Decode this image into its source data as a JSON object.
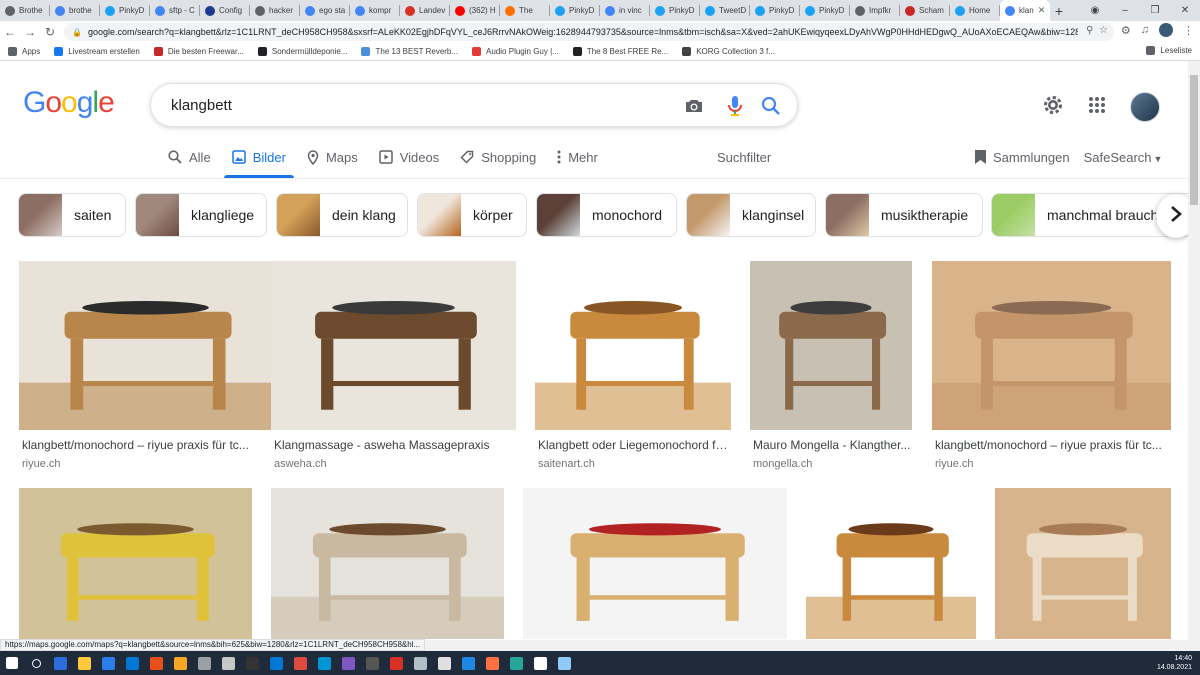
{
  "browser": {
    "tabs": [
      {
        "label": "Brothe",
        "color": "#5f6368",
        "icon": "globe-icon"
      },
      {
        "label": "brothe",
        "color": "#4285f4",
        "icon": "google-icon"
      },
      {
        "label": "PinkyD",
        "color": "#1da1f2",
        "icon": "twitter-icon"
      },
      {
        "label": "sftp - C",
        "color": "#4285f4",
        "icon": "google-icon"
      },
      {
        "label": "Config",
        "color": "#1a3a8f",
        "icon": "config-icon"
      },
      {
        "label": "hacker",
        "color": "#5f6368",
        "icon": "globe-icon"
      },
      {
        "label": "ego sta",
        "color": "#4285f4",
        "icon": "google-icon"
      },
      {
        "label": "kompr",
        "color": "#4285f4",
        "icon": "google-icon"
      },
      {
        "label": "Landev",
        "color": "#d93025",
        "icon": "bookmark-icon"
      },
      {
        "label": "(362) H",
        "color": "#ff0000",
        "icon": "youtube-icon"
      },
      {
        "label": "The",
        "color": "#ff6f00",
        "icon": "audio-icon"
      },
      {
        "label": "PinkyD",
        "color": "#1da1f2",
        "icon": "twitter-icon"
      },
      {
        "label": "in vinc",
        "color": "#4285f4",
        "icon": "google-icon"
      },
      {
        "label": "PinkyD",
        "color": "#1da1f2",
        "icon": "twitter-icon"
      },
      {
        "label": "TweetD",
        "color": "#1da1f2",
        "icon": "tweetdeck-icon"
      },
      {
        "label": "PinkyD",
        "color": "#1da1f2",
        "icon": "twitter-icon"
      },
      {
        "label": "PinkyD",
        "color": "#1da1f2",
        "icon": "twitter-icon"
      },
      {
        "label": "Impfkr",
        "color": "#5f6368",
        "icon": "wikipedia-icon"
      },
      {
        "label": "Scham",
        "color": "#c62828",
        "icon": "bookmark-icon"
      },
      {
        "label": "Home",
        "color": "#1da1f2",
        "icon": "twitter-icon"
      }
    ],
    "active_tab": {
      "label": "klan",
      "color": "#4285f4"
    },
    "url": "google.com/search?q=klangbett&rlz=1C1LRNT_deCH958CH958&sxsrf=ALeKK02EgjhDFqVYL_ceJ6RrrvNAkOWeig:1628944793735&source=lnms&tbm=isch&sa=X&ved=2ahUKEwiqyqeexLDyAhVWgP0HHdHEDgwQ_AUoAXoECAEQAw&biw=1280&bih=...",
    "bookmarks": [
      {
        "label": "Apps",
        "color": "#5f6368"
      },
      {
        "label": "Livestream erstellen",
        "color": "#1877f2"
      },
      {
        "label": "Die besten Freewar...",
        "color": "#c62828"
      },
      {
        "label": "Sondermülldeponie...",
        "color": "#202124"
      },
      {
        "label": "The 13 BEST Reverb...",
        "color": "#4a90d9"
      },
      {
        "label": "Audio Plugin Guy |...",
        "color": "#e53935"
      },
      {
        "label": "The 8 Best FREE Re...",
        "color": "#202124"
      },
      {
        "label": "KORG Collection 3 f...",
        "color": "#424242"
      }
    ],
    "reading_list": "Leseliste"
  },
  "search": {
    "query": "klangbett"
  },
  "nav": {
    "tabs": [
      {
        "label": "Alle",
        "icon": "search-icon"
      },
      {
        "label": "Bilder",
        "icon": "image-icon",
        "active": true
      },
      {
        "label": "Maps",
        "icon": "map-pin-icon"
      },
      {
        "label": "Videos",
        "icon": "video-icon"
      },
      {
        "label": "Shopping",
        "icon": "tag-icon"
      },
      {
        "label": "Mehr",
        "icon": "more-vert-icon"
      }
    ],
    "suchfilter": "Suchfilter",
    "sammlungen": "Sammlungen",
    "safesearch": "SafeSearch"
  },
  "chips": [
    {
      "label": "saiten",
      "c1": "#8d6e63",
      "c2": "#d7ccc8"
    },
    {
      "label": "klangliege",
      "c1": "#a1887f",
      "c2": "#6d4c41"
    },
    {
      "label": "dein klang",
      "c1": "#d4a15a",
      "c2": "#8a5a2b"
    },
    {
      "label": "körper",
      "c1": "#efe6dc",
      "c2": "#b5651d"
    },
    {
      "label": "monochord",
      "c1": "#5d4037",
      "c2": "#cfd8dc"
    },
    {
      "label": "klanginsel",
      "c1": "#c49a6c",
      "c2": "#f5f5f5"
    },
    {
      "label": "musiktherapie",
      "c1": "#8d6e63",
      "c2": "#e0c9a6"
    },
    {
      "label": "manchmal braucht",
      "c1": "#9ccc65",
      "c2": "#c5e1a5"
    }
  ],
  "results_row1": [
    {
      "title": "klangbett/monochord – riyue praxis für tc...",
      "source": "riyue.ch",
      "c1": "#e8e2d8",
      "c2": "#b8864b",
      "c3": "#2b2b2b"
    },
    {
      "title": "Klangmassage - asweha Massagepraxis",
      "source": "asweha.ch",
      "c1": "#e9e4dc",
      "c2": "#6b4a2e",
      "c3": "#3a3a3a"
    },
    {
      "title": "Klangbett oder Liegemonochord fü...",
      "source": "saitenart.ch",
      "c1": "#ffffff",
      "c2": "#c98a3e",
      "c3": "#8a5524"
    },
    {
      "title": "Mauro Mongella - Klangther...",
      "source": "mongella.ch",
      "c1": "#c9c0b4",
      "c2": "#8a6a4a",
      "c3": "#3d3d3d"
    },
    {
      "title": "klangbett/monochord – riyue praxis für tc...",
      "source": "riyue.ch",
      "c1": "#d9b48a",
      "c2": "#c4956a",
      "c3": "#8a6a52"
    }
  ],
  "results_row2": [
    {
      "c1": "#d2c29a",
      "c2": "#e0c13a",
      "c3": "#7a5a2e"
    },
    {
      "c1": "#e6e2dc",
      "c2": "#c9b9a0",
      "c3": "#6b4a2e"
    },
    {
      "c1": "#f4f4f4",
      "c2": "#d9b070",
      "c3": "#b22222"
    },
    {
      "c1": "#ffffff",
      "c2": "#c98a3e",
      "c3": "#6b3a1a"
    },
    {
      "c1": "#d7b48c",
      "c2": "#eadcc6",
      "c3": "#a97b55"
    }
  ],
  "status_url": "https://maps.google.com/maps?q=klangbett&source=lnms&bih=625&biw=1280&rlz=1C1LRNT_deCH958CH958&hl...",
  "clock": {
    "time": "14:40",
    "date": "14.08.2021"
  }
}
